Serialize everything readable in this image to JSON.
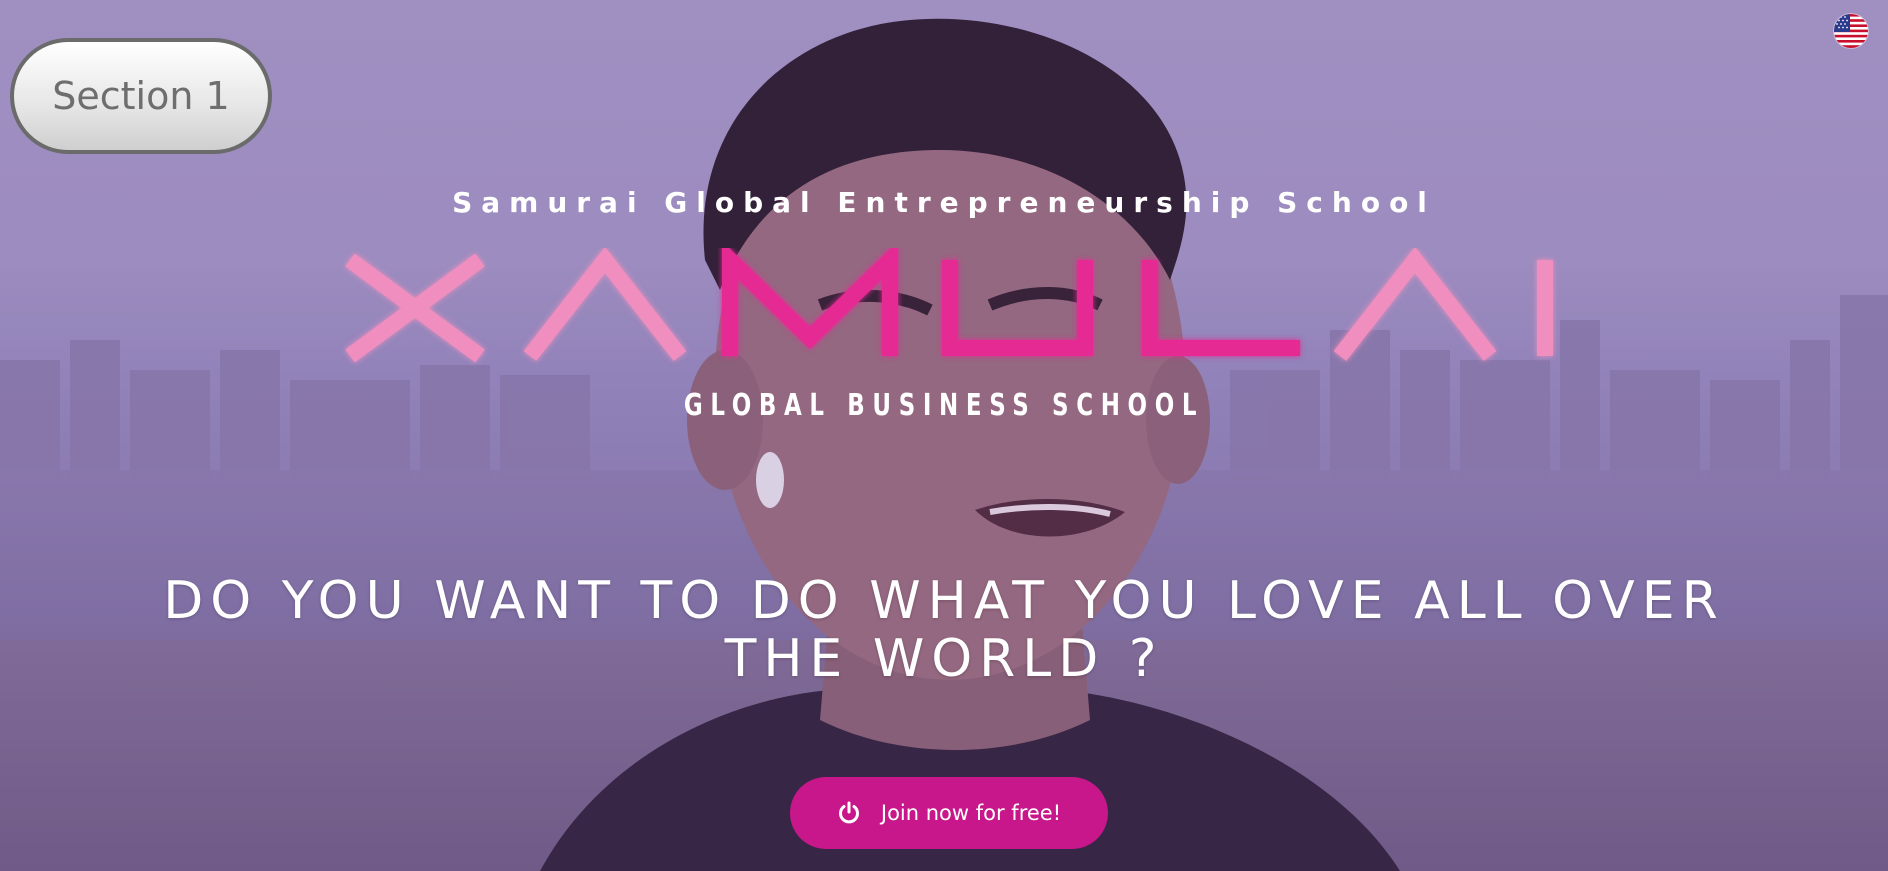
{
  "section_pill": {
    "label": "Section 1"
  },
  "language": {
    "icon": "us-flag-icon"
  },
  "hero": {
    "tagline": "Samurai Global Entrepreneurship School",
    "logo_text": "XAMULAI",
    "subtitle": "GLOBAL BUSINESS SCHOOL",
    "headline_line1": "DO YOU WANT TO DO WHAT YOU LOVE ALL OVER",
    "headline_line2": "THE WORLD ?",
    "cta_label": "Join now for free!",
    "cta_icon": "power-icon"
  },
  "colors": {
    "accent": "#c8178a",
    "logo_pink": "#e62a94",
    "logo_light_pink": "#f08fbf"
  }
}
